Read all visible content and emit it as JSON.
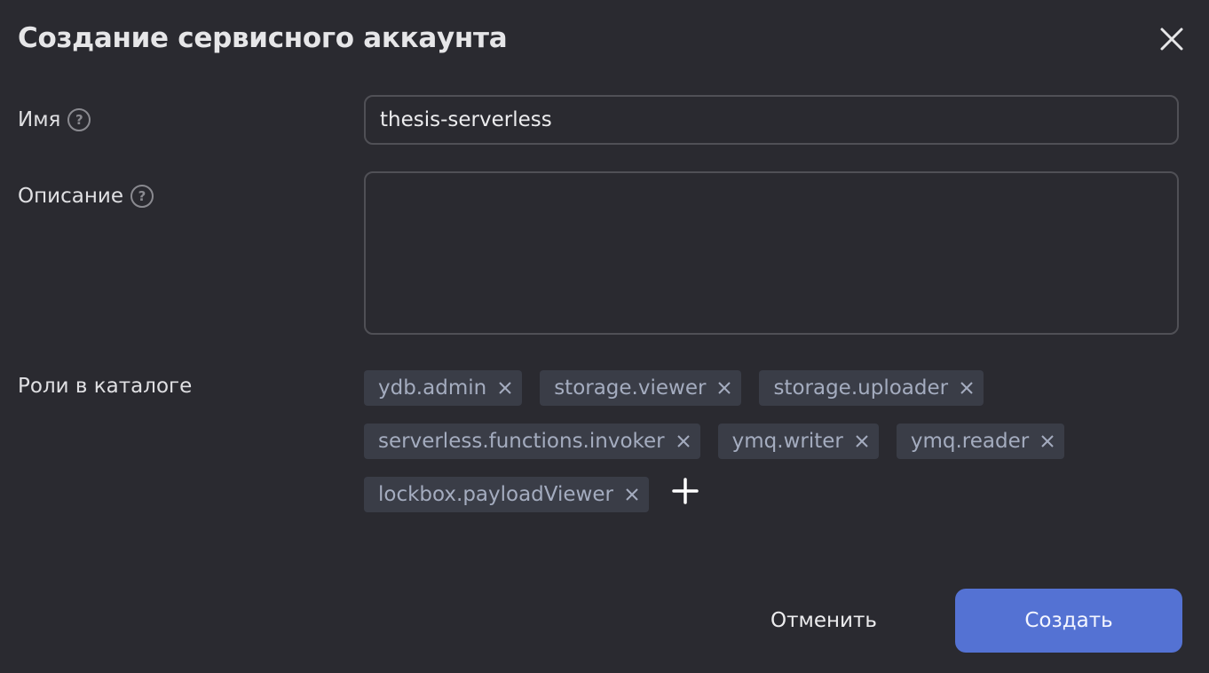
{
  "dialog": {
    "title": "Создание сервисного аккаунта",
    "close_icon": "close-icon"
  },
  "fields": {
    "name": {
      "label": "Имя",
      "help_glyph": "?",
      "value": "thesis-serverless"
    },
    "description": {
      "label": "Описание",
      "help_glyph": "?",
      "value": ""
    },
    "roles": {
      "label": "Роли в каталоге",
      "items": [
        "ydb.admin",
        "storage.viewer",
        "storage.uploader",
        "serverless.functions.invoker",
        "ymq.writer",
        "ymq.reader",
        "lockbox.payloadViewer"
      ],
      "add_icon": "plus-icon"
    }
  },
  "actions": {
    "cancel_label": "Отменить",
    "create_label": "Создать"
  },
  "colors": {
    "background": "#2a2a30",
    "chip_bg": "#3a3d47",
    "chip_text": "#a4acbf",
    "primary": "#5472d3"
  }
}
